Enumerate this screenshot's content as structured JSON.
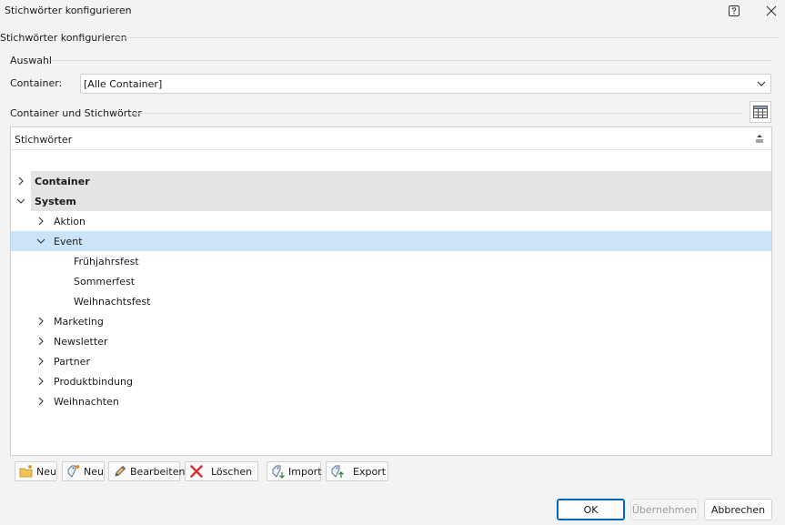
{
  "window": {
    "title": "Stichwörter konfigurieren"
  },
  "group": {
    "title": "Stichwörter konfigurieren"
  },
  "auswahl": {
    "title": "Auswahl",
    "container_label": "Container:",
    "container_value": "[Alle Container]"
  },
  "tree_section": {
    "title": "Container und Stichwörter",
    "column_header": "Stichwörter",
    "nodes": [
      {
        "label": "Container",
        "level": 0,
        "expanded": false,
        "group": true
      },
      {
        "label": "System",
        "level": 0,
        "expanded": true,
        "group": true
      },
      {
        "label": "Aktion",
        "level": 1,
        "expanded": false
      },
      {
        "label": "Event",
        "level": 1,
        "expanded": true,
        "selected": true
      },
      {
        "label": "Frühjahrsfest",
        "level": 2
      },
      {
        "label": "Sommerfest",
        "level": 2
      },
      {
        "label": "Weihnachtsfest",
        "level": 2
      },
      {
        "label": "Marketing",
        "level": 1,
        "expanded": false
      },
      {
        "label": "Newsletter",
        "level": 1,
        "expanded": false
      },
      {
        "label": "Partner",
        "level": 1,
        "expanded": false
      },
      {
        "label": "Produktbindung",
        "level": 1,
        "expanded": false
      },
      {
        "label": "Weihnachten",
        "level": 1,
        "expanded": false
      }
    ]
  },
  "toolbar": {
    "new_container": "Neu",
    "new_keyword": "Neu",
    "edit": "Bearbeiten",
    "delete": "Löschen",
    "import": "Import",
    "export": "Export"
  },
  "dialog_buttons": {
    "ok": "OK",
    "apply": "Übernehmen",
    "cancel": "Abbrechen"
  },
  "colors": {
    "selection": "#cce4f7",
    "group_band": "#e4e4e4",
    "accent": "#0067c0",
    "delete_red": "#d13438"
  }
}
